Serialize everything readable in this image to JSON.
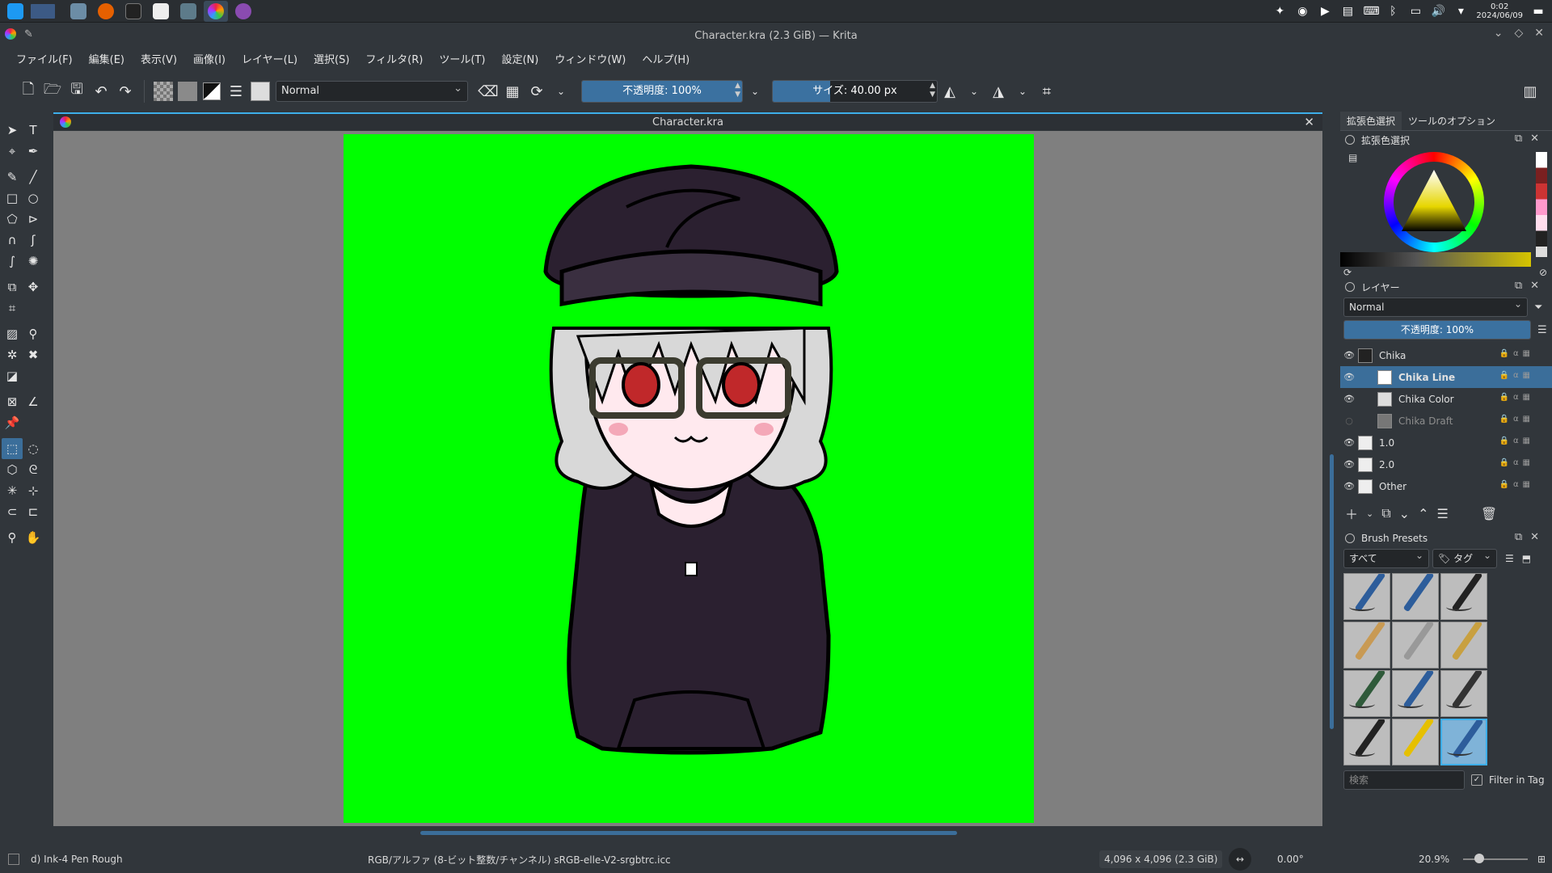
{
  "taskbar": {
    "clock_time": "0:02",
    "clock_date": "2024/06/09"
  },
  "window": {
    "title": "Character.kra (2.3 GiB) — Krita"
  },
  "menu": [
    "ファイル(F)",
    "編集(E)",
    "表示(V)",
    "画像(I)",
    "レイヤー(L)",
    "選択(S)",
    "フィルタ(R)",
    "ツール(T)",
    "設定(N)",
    "ウィンドウ(W)",
    "ヘルプ(H)"
  ],
  "toolbar": {
    "blend_mode": "Normal",
    "opacity_label": "不透明度: 100%",
    "opacity_fraction": 1.0,
    "size_label": "サイズ: 40.00 px",
    "size_fraction": 0.35
  },
  "document": {
    "tab_title": "Character.kra"
  },
  "docker": {
    "tabs": [
      "拡張色選択",
      "ツールのオプション"
    ],
    "color_panel_title": "拡張色選択",
    "layers_panel_title": "レイヤー",
    "layer_blend_mode": "Normal",
    "layer_opacity_label": "不透明度: 100%",
    "layers": [
      {
        "name": "Chika",
        "selected": false,
        "dim": false
      },
      {
        "name": "Chika Line",
        "selected": true,
        "dim": false
      },
      {
        "name": "Chika Color",
        "selected": false,
        "dim": false
      },
      {
        "name": "Chika Draft",
        "selected": false,
        "dim": true
      },
      {
        "name": "1.0",
        "selected": false,
        "dim": false
      },
      {
        "name": "2.0",
        "selected": false,
        "dim": false
      },
      {
        "name": "Other",
        "selected": false,
        "dim": false
      }
    ],
    "brush_panel_title": "Brush Presets",
    "brush_filter": "すべて",
    "brush_tag": "タグ",
    "search_placeholder": "検索",
    "filter_in_tag": "Filter in Tag"
  },
  "status": {
    "brush_name": "d) Ink-4 Pen Rough",
    "color_info": "RGB/アルファ (8-ビット整数/チャンネル)  sRGB-elle-V2-srgbtrc.icc",
    "image_size": "4,096 x 4,096 (2.3 GiB)",
    "rotation": "0.00°",
    "zoom": "20.9%"
  },
  "colors": {
    "canvas_bg": "#00ff00",
    "accent": "#3daee9",
    "hoodie": "#2b2030",
    "hair": "#d8d8d8",
    "eyes": "#c0282a"
  }
}
